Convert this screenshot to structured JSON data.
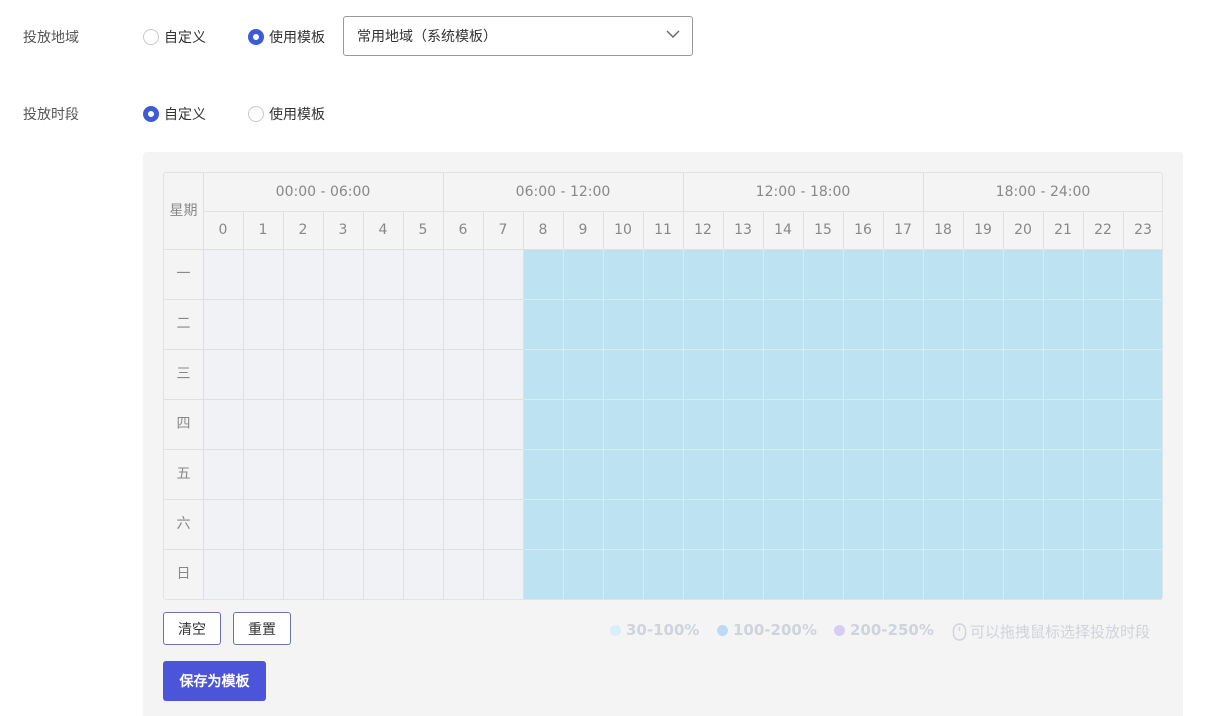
{
  "region": {
    "label": "投放地域",
    "options": [
      "自定义",
      "使用模板"
    ],
    "selected": 1,
    "select_value": "常用地域（系统模板）"
  },
  "period": {
    "label": "投放时段",
    "options": [
      "自定义",
      "使用模板"
    ],
    "selected": 0
  },
  "grid": {
    "corner": "星期",
    "ranges": [
      "00:00 - 06:00",
      "06:00 - 12:00",
      "12:00 - 18:00",
      "18:00 - 24:00"
    ],
    "hours": [
      "0",
      "1",
      "2",
      "3",
      "4",
      "5",
      "6",
      "7",
      "8",
      "9",
      "10",
      "11",
      "12",
      "13",
      "14",
      "15",
      "16",
      "17",
      "18",
      "19",
      "20",
      "21",
      "22",
      "23"
    ],
    "days": [
      "一",
      "二",
      "三",
      "四",
      "五",
      "六",
      "日"
    ],
    "selected_hour_start": 8,
    "selected_hour_end": 24,
    "selected_color": "#bde3f3"
  },
  "buttons": {
    "clear": "清空",
    "reset": "重置",
    "save_template": "保存为模板"
  },
  "legend": [
    {
      "label": "30-100%",
      "color": "#d9eef8"
    },
    {
      "label": "100-200%",
      "color": "#bcd9f6"
    },
    {
      "label": "200-250%",
      "color": "#d6cdf1"
    }
  ],
  "hint": "可以拖拽鼠标选择投放时段",
  "hint_icon": "mouse-icon"
}
